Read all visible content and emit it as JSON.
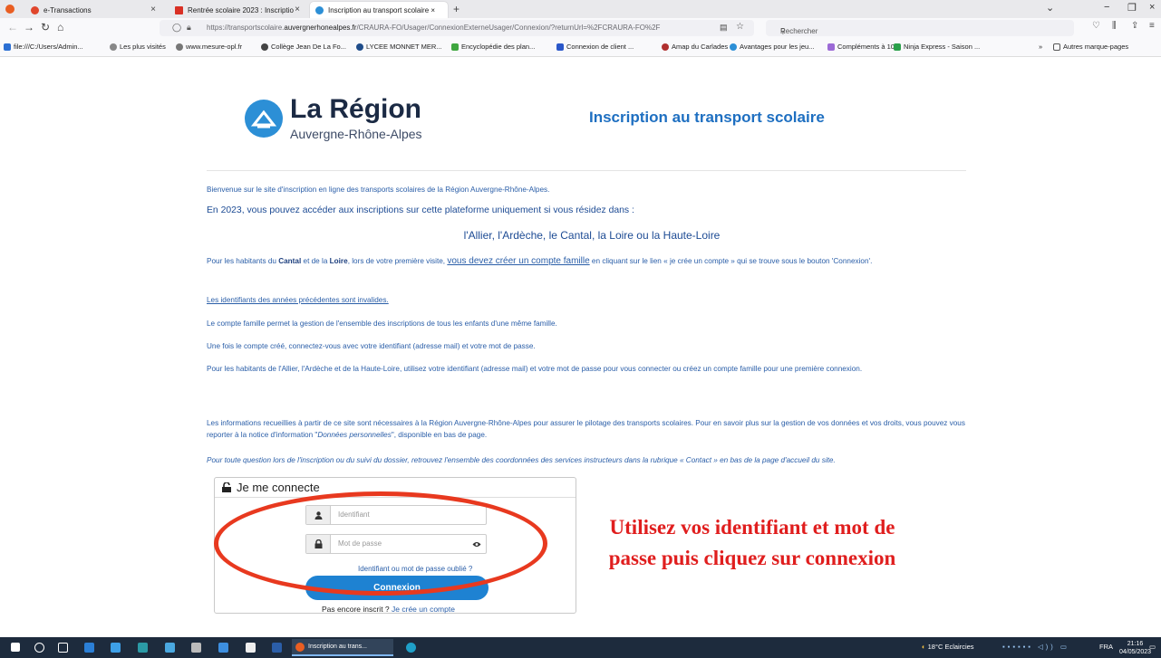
{
  "browser": {
    "tabs": [
      {
        "label": "e-Transactions",
        "color": "#e0462c"
      },
      {
        "label": "Rentrée scolaire 2023 : Inscriptio",
        "color": "#d93025"
      },
      {
        "label": "Inscription au transport scolaire ×",
        "color": "#2c8fd6"
      }
    ],
    "new_tab": "+",
    "url_prefix": "https://transportscolaire.",
    "url_host": "auvergnerhonealpes.fr",
    "url_rest": "/CRAURA-FO/Usager/ConnexionExterneUsager/Connexion/?returnUrl=%2FCRAURA-FO%2F",
    "search_placeholder": "Rechercher",
    "bookmarks": [
      "file:///C:/Users/Admin...",
      "Les plus visités",
      "www.mesure-opl.fr",
      "Collège Jean De La Fo...",
      "LYCEE MONNET MER...",
      "Encyclopédie des plan...",
      "Connexion de client ...",
      "Amap du Carlades",
      "Avantages pour les jeu...",
      "Compléments à 10",
      "Ninja Express - Saison ..."
    ],
    "other_bookmarks": "Autres marque-pages"
  },
  "header": {
    "logo_name": "La Région",
    "logo_sub": "Auvergne-Rhône-Alpes",
    "title": "Inscription au transport scolaire"
  },
  "content": {
    "welcome": "Bienvenue sur le site d'inscription en ligne des transports scolaires de la Région Auvergne-Rhône-Alpes.",
    "year_intro": "En 2023, vous pouvez accéder aux inscriptions sur cette plateforme uniquement si vous résidez dans :",
    "departments": "l'Allier, l'Ardèche, le Cantal, la Loire ou la Haute-Loire",
    "cantal_1": "Pour les habitants du ",
    "cantal_b1": "Cantal",
    "cantal_2": " et de la ",
    "cantal_b2": "Loire",
    "cantal_3": ", lors de votre première visite, ",
    "cantal_link": "vous devez créer un compte famille",
    "cantal_4": " en cliquant sur le lien « je crée un compte » qui se trouve sous le bouton 'Connexion'.",
    "invalid_ids": "Les identifiants des années précédentes sont invalides.",
    "family_account": "Le compte famille permet la gestion de l'ensemble des inscriptions de tous les enfants d'une même famille.",
    "once_created": "Une fois le compte créé, connectez-vous avec votre identifiant (adresse mail) et votre mot de passe.",
    "others": "Pour les habitants de l'Allier, l'Ardèche et de la Haute-Loire, utilisez votre identifiant (adresse mail) et votre mot de passe pour vous connecter ou créez un compte famille pour une première connexion.",
    "privacy_1": "Les informations recueillies à partir de ce site sont nécessaires à la Région Auvergne-Rhône-Alpes pour assurer le pilotage des transports scolaires. Pour en savoir plus sur la gestion de vos données et vos droits, vous pouvez vous reporter à la notice d'information \"",
    "privacy_em": "Données personnelles",
    "privacy_2": "\", disponible en bas de page.",
    "contact": "Pour toute question lors de l'inscription ou du suivi du dossier, retrouvez l'ensemble des coordonnées des services instructeurs dans la rubrique « Contact » en bas de la page d'accueil du site."
  },
  "login": {
    "heading": "Je me connecte",
    "identifier_placeholder": "Identifiant",
    "password_placeholder": "Mot de passe",
    "forgot": "Identifiant ou mot de passe oublié ?",
    "submit": "Connexion",
    "signup_prefix": "Pas encore inscrit ?",
    "signup_link": "Je crée un compte"
  },
  "annotation": {
    "text": "Utilisez vos identifiant et mot de passe puis cliquez sur connexion",
    "color": "#e01e1e"
  },
  "taskbar": {
    "active_app": "Inscription au trans...",
    "weather": "18°C  Eclaircies",
    "lang": "FRA",
    "time": "21:16",
    "date": "04/05/2023"
  }
}
